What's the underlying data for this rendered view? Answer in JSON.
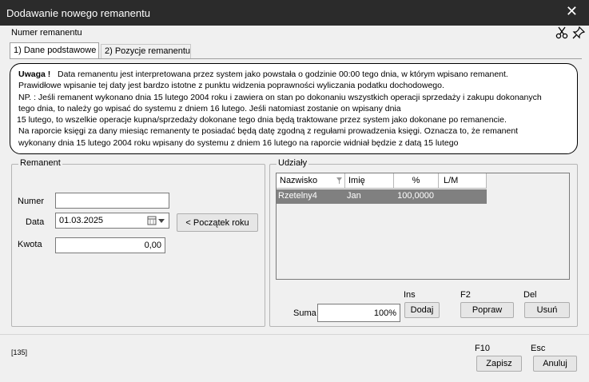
{
  "window": {
    "title": "Dodawanie nowego remanentu"
  },
  "header": {
    "label": "Numer remanentu",
    "scissors_icon": "scissors-icon",
    "pin_icon": "pin-icon"
  },
  "tabs": [
    {
      "label": "1) Dane podstawowe"
    },
    {
      "label": "2) Pozycje remanentu"
    }
  ],
  "notice": {
    "heading": "Uwaga !",
    "lines": [
      "Data remanentu jest interpretowana przez system jako powstała o godzinie 00:00 tego dnia, w którym wpisano remanent.",
      "Prawidłowe wpisanie tej daty jest bardzo istotne z punktu widzenia poprawności wyliczania podatku dochodowego.",
      "NP. : Jeśli remanent wykonano dnia 15 lutego 2004 roku i zawiera on stan po dokonaniu wszystkich operacji sprzedaży i zakupu dokonanych",
      "tego dnia, to należy go wpisać do systemu z dniem 16 lutego. Jeśli natomiast zostanie on wpisany dnia",
      "15 lutego, to wszelkie operacje kupna/sprzedaży dokonane tego dnia będą traktowane przez system jako dokonane po remanencie.",
      "Na raporcie księgi za dany miesiąc remanenty te posiadać będą datę zgodną z regułami prowadzenia księgi. Oznacza to, że remanent",
      "wykonany dnia 15 lutego 2004 roku wpisany do systemu z dniem 16 lutego na raporcie widniał będzie z datą 15 lutego"
    ]
  },
  "remanent": {
    "title": "Remanent",
    "numer_label": "Numer",
    "numer_value": "",
    "data_label": "Data",
    "data_value": "01.03.2025",
    "start_year_button": "< Początek roku",
    "kwota_label": "Kwota",
    "kwota_value": "0,00"
  },
  "udzialy": {
    "title": "Udziały",
    "columns": [
      "Nazwisko",
      "Imię",
      "%",
      "L/M"
    ],
    "rows": [
      {
        "nazwisko": "Rzetelny4",
        "imie": "Jan",
        "procent": "100,0000",
        "lm": ""
      }
    ],
    "suma_label": "Suma",
    "suma_value": "100%",
    "shortcut_add": "Ins",
    "shortcut_edit": "F2",
    "shortcut_delete": "Del",
    "add_button": "Dodaj",
    "edit_button": "Popraw",
    "delete_button": "Usuń"
  },
  "footer": {
    "id_text": "[135]",
    "save_shortcut": "F10",
    "cancel_shortcut": "Esc",
    "save_button": "Zapisz",
    "cancel_button": "Anuluj"
  }
}
